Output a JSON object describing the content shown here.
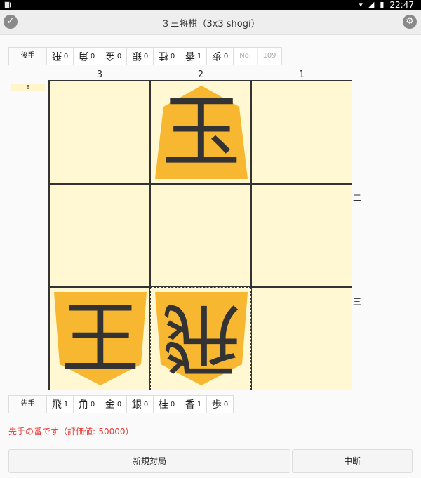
{
  "statusbar": {
    "time": "22:47"
  },
  "app": {
    "title": "３三将棋（3x3 shogi）"
  },
  "gote_hand": {
    "label": "後手",
    "pieces": [
      {
        "kanji": "飛",
        "count": "0"
      },
      {
        "kanji": "角",
        "count": "0"
      },
      {
        "kanji": "金",
        "count": "0"
      },
      {
        "kanji": "銀",
        "count": "0"
      },
      {
        "kanji": "桂",
        "count": "0"
      },
      {
        "kanji": "香",
        "count": "1"
      },
      {
        "kanji": "歩",
        "count": "0"
      }
    ],
    "no_label": "No.",
    "no_value": "109"
  },
  "sente_hand": {
    "label": "先手",
    "pieces": [
      {
        "kanji": "飛",
        "count": "1"
      },
      {
        "kanji": "角",
        "count": "0"
      },
      {
        "kanji": "金",
        "count": "0"
      },
      {
        "kanji": "銀",
        "count": "0"
      },
      {
        "kanji": "桂",
        "count": "0"
      },
      {
        "kanji": "香",
        "count": "1"
      },
      {
        "kanji": "歩",
        "count": "0"
      }
    ]
  },
  "board": {
    "columns": [
      "3",
      "2",
      "1"
    ],
    "rows": [
      "一",
      "二",
      "三"
    ],
    "move_number": "8",
    "squares": [
      [
        null,
        {
          "kanji": "玉",
          "owner": "gote"
        },
        null
      ],
      [
        null,
        null,
        null
      ],
      [
        {
          "kanji": "王",
          "owner": "sente"
        },
        {
          "kanji": "飛",
          "owner": "gote"
        },
        null
      ]
    ],
    "piece_color": "#f7b731"
  },
  "status": {
    "message": "先手の番です（評価値:-50000）"
  },
  "actions": {
    "new_game": "新規対局",
    "abort": "中断"
  }
}
